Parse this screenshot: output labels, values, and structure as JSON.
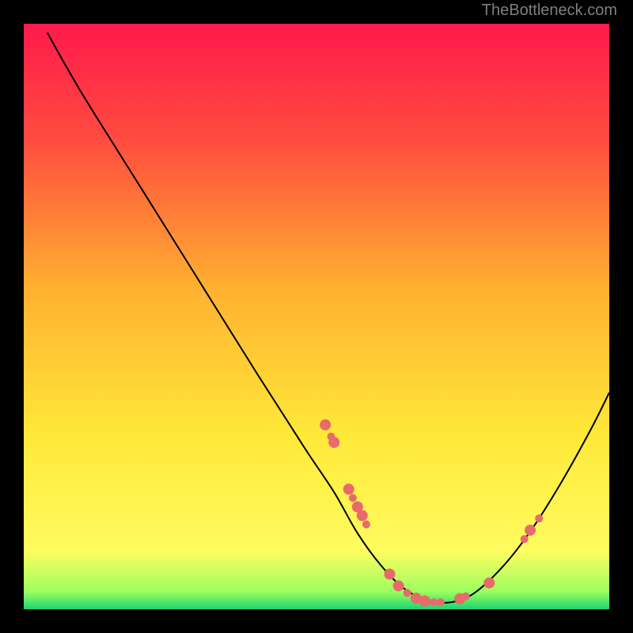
{
  "attribution": "TheBottleneck.com",
  "chart_data": {
    "type": "line",
    "title": "",
    "xlabel": "",
    "ylabel": "",
    "xlim": [
      0,
      100
    ],
    "ylim": [
      0,
      100
    ],
    "background": {
      "kind": "vertical-gradient",
      "stops": [
        {
          "t": 0.0,
          "color": "#ff1a4b"
        },
        {
          "t": 0.2,
          "color": "#ff4c3f"
        },
        {
          "t": 0.45,
          "color": "#ffb030"
        },
        {
          "t": 0.7,
          "color": "#ffe838"
        },
        {
          "t": 0.9,
          "color": "#fffc60"
        },
        {
          "t": 0.97,
          "color": "#9bff60"
        },
        {
          "t": 1.0,
          "color": "#1cd370"
        }
      ]
    },
    "series": [
      {
        "name": "curve",
        "color": "#000000",
        "points": [
          {
            "x": 4.0,
            "y": 98.5
          },
          {
            "x": 10.0,
            "y": 88.0
          },
          {
            "x": 20.0,
            "y": 72.0
          },
          {
            "x": 30.0,
            "y": 56.0
          },
          {
            "x": 40.0,
            "y": 40.0
          },
          {
            "x": 48.0,
            "y": 27.5
          },
          {
            "x": 53.0,
            "y": 20.0
          },
          {
            "x": 57.0,
            "y": 13.0
          },
          {
            "x": 61.0,
            "y": 7.5
          },
          {
            "x": 65.0,
            "y": 3.5
          },
          {
            "x": 69.0,
            "y": 1.5
          },
          {
            "x": 73.0,
            "y": 1.2
          },
          {
            "x": 77.0,
            "y": 2.8
          },
          {
            "x": 82.0,
            "y": 7.5
          },
          {
            "x": 87.0,
            "y": 14.0
          },
          {
            "x": 92.0,
            "y": 22.0
          },
          {
            "x": 97.0,
            "y": 31.0
          },
          {
            "x": 100.0,
            "y": 37.0
          }
        ]
      }
    ],
    "markers": {
      "color": "#e86a6a",
      "radius_small": 5,
      "radius_large": 7,
      "points": [
        {
          "x": 51.5,
          "y": 31.5,
          "r": 7
        },
        {
          "x": 52.5,
          "y": 29.5,
          "r": 5
        },
        {
          "x": 53.0,
          "y": 28.5,
          "r": 7
        },
        {
          "x": 55.5,
          "y": 20.5,
          "r": 7
        },
        {
          "x": 56.2,
          "y": 19.0,
          "r": 5
        },
        {
          "x": 57.0,
          "y": 17.5,
          "r": 7
        },
        {
          "x": 57.8,
          "y": 16.0,
          "r": 7
        },
        {
          "x": 58.5,
          "y": 14.5,
          "r": 5
        },
        {
          "x": 62.5,
          "y": 6.0,
          "r": 7
        },
        {
          "x": 64.0,
          "y": 4.0,
          "r": 7
        },
        {
          "x": 65.5,
          "y": 2.8,
          "r": 5
        },
        {
          "x": 67.0,
          "y": 1.9,
          "r": 7
        },
        {
          "x": 68.5,
          "y": 1.4,
          "r": 7
        },
        {
          "x": 70.0,
          "y": 1.2,
          "r": 5
        },
        {
          "x": 71.2,
          "y": 1.2,
          "r": 5
        },
        {
          "x": 74.5,
          "y": 1.8,
          "r": 7
        },
        {
          "x": 75.5,
          "y": 2.2,
          "r": 5
        },
        {
          "x": 79.5,
          "y": 4.5,
          "r": 7
        },
        {
          "x": 85.5,
          "y": 12.0,
          "r": 5
        },
        {
          "x": 86.5,
          "y": 13.5,
          "r": 7
        },
        {
          "x": 88.0,
          "y": 15.5,
          "r": 5
        }
      ]
    }
  }
}
